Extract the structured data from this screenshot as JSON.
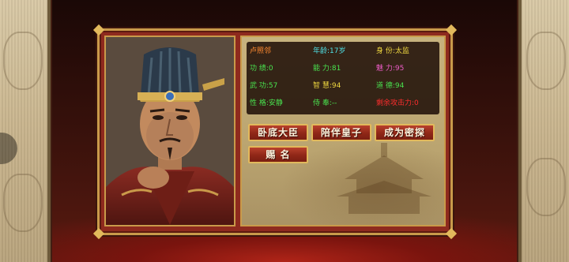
{
  "character": {
    "name": "卢照邻",
    "age": "年龄:17岁",
    "identity": "身 份:太监",
    "merit": "功 绩:0",
    "ability": "能 力:81",
    "charm": "魅 力:95",
    "martial": "武 功:57",
    "wisdom": "智 慧:94",
    "morality": "道 德:94",
    "personality": "性 格:安静",
    "attendance": "侍 奉:--",
    "rebel": "剩余攻击力:0"
  },
  "actions": {
    "undercover": "卧底大臣",
    "accompany": "陪伴皇子",
    "spy": "成为密探",
    "rename": "赐 名"
  },
  "colors": {
    "name": "#ff8a30",
    "cyan": "#4fe0e6",
    "yellow": "#f0d840",
    "green": "#49e34f",
    "pink": "#ee5cc8",
    "red": "#ff2d2d"
  },
  "icons": {
    "portrait": "eunuch-portrait",
    "background": "palace-silhouette"
  }
}
